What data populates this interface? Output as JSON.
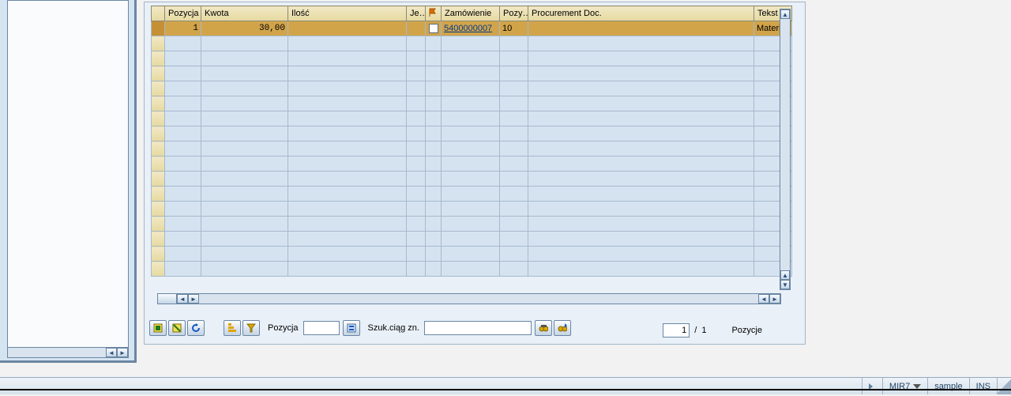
{
  "grid": {
    "columns": [
      "Pozycja",
      "Kwota",
      "Ilość",
      "Je…",
      "",
      "Zamówienie",
      "Pozy…",
      "Procurement Doc.",
      "Tekst za"
    ],
    "row": {
      "pozycja": "1",
      "kwota": "30,00",
      "ilosc": "",
      "je": "",
      "zamowienie": "5400000007",
      "pozycja_zam": "10",
      "procurement": "",
      "tekst": "Materiał"
    }
  },
  "toolbar": {
    "pozycja_label": "Pozycja",
    "szuk_label": "Szuk.ciąg zn.",
    "pozycja_value": "",
    "szuk_value": ""
  },
  "pager": {
    "current": "1",
    "sep": "/",
    "total": "1",
    "label": "Pozycje"
  },
  "status": {
    "tcode": "MIR7",
    "session": "sample",
    "mode": "INS"
  }
}
